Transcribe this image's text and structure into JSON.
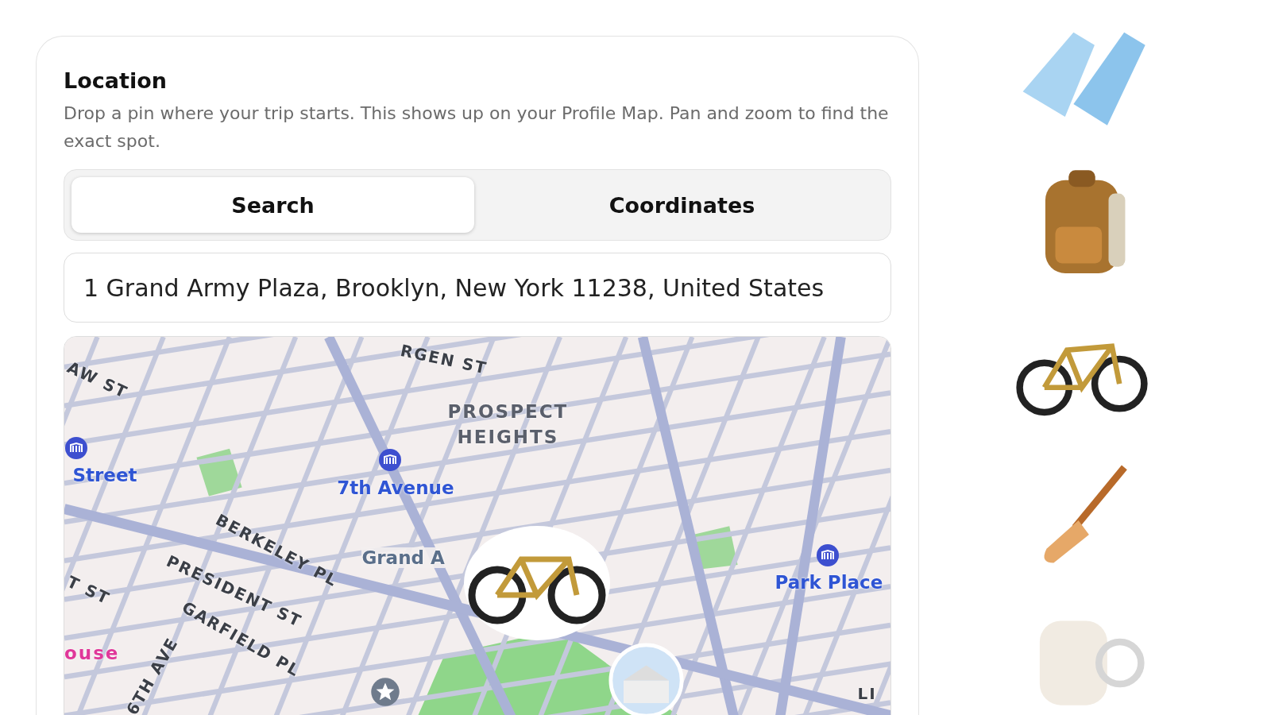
{
  "location": {
    "title": "Location",
    "description": "Drop a pin where your trip starts. This shows up on your Profile Map. Pan and zoom to find the exact spot.",
    "tabs": [
      {
        "label": "Search",
        "selected": true
      },
      {
        "label": "Coordinates",
        "selected": false
      }
    ],
    "address": {
      "value": "1 Grand Army Plaza, Brooklyn, New York 11238, United States"
    },
    "map": {
      "labels": [
        {
          "text": "RGEN ST",
          "kind": "street"
        },
        {
          "text": "AW ST",
          "kind": "street"
        },
        {
          "text": "PROSPECT HEIGHTS",
          "kind": "area"
        },
        {
          "text": "Street",
          "kind": "station"
        },
        {
          "text": "7th Avenue",
          "kind": "station"
        },
        {
          "text": "BERKELEY PL",
          "kind": "street"
        },
        {
          "text": "PRESIDENT ST",
          "kind": "street"
        },
        {
          "text": "Grand A",
          "kind": "place"
        },
        {
          "text": "Park Place",
          "kind": "station"
        },
        {
          "text": "T ST",
          "kind": "street"
        },
        {
          "text": "GARFIELD PL",
          "kind": "street"
        },
        {
          "text": "ouse",
          "kind": "poi"
        },
        {
          "text": "6TH AVE",
          "kind": "street"
        },
        {
          "text": "LI",
          "kind": "street"
        }
      ]
    }
  },
  "gear": [
    {
      "kind": "flippers"
    },
    {
      "kind": "backpack"
    },
    {
      "kind": "bicycle"
    },
    {
      "kind": "paddle"
    },
    {
      "kind": "faded"
    }
  ]
}
